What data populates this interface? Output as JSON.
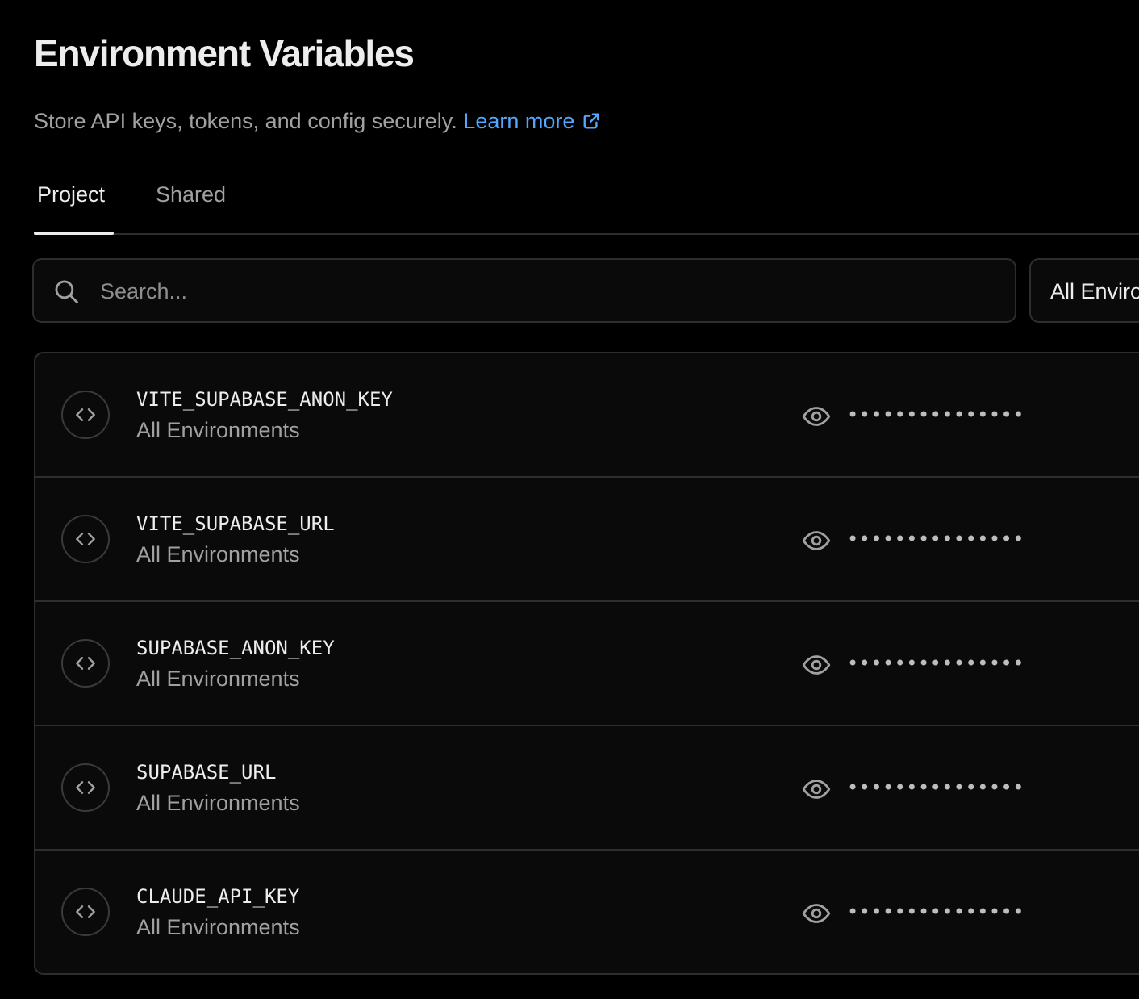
{
  "header": {
    "title": "Environment Variables",
    "subtitle": "Store API keys, tokens, and config securely.",
    "learn_more": "Learn more",
    "learn_more_icon": "external-link-icon"
  },
  "tabs": [
    {
      "label": "Project",
      "active": true
    },
    {
      "label": "Shared",
      "active": false
    }
  ],
  "search": {
    "placeholder": "Search...",
    "value": "",
    "icon": "search-icon"
  },
  "environment_filter": {
    "selected": "All Environments"
  },
  "variables": [
    {
      "name": "VITE_SUPABASE_ANON_KEY",
      "environment": "All Environments",
      "masked_value": "•••••••••••••••"
    },
    {
      "name": "VITE_SUPABASE_URL",
      "environment": "All Environments",
      "masked_value": "•••••••••••••••"
    },
    {
      "name": "SUPABASE_ANON_KEY",
      "environment": "All Environments",
      "masked_value": "•••••••••••••••"
    },
    {
      "name": "SUPABASE_URL",
      "environment": "All Environments",
      "masked_value": "•••••••••••••••"
    },
    {
      "name": "CLAUDE_API_KEY",
      "environment": "All Environments",
      "masked_value": "•••••••••••••••"
    }
  ],
  "colors": {
    "background": "#000000",
    "surface": "#0a0a0a",
    "border": "#2e2e2e",
    "text_primary": "#ededed",
    "text_secondary": "#a1a1a1",
    "link": "#52a8ff"
  }
}
